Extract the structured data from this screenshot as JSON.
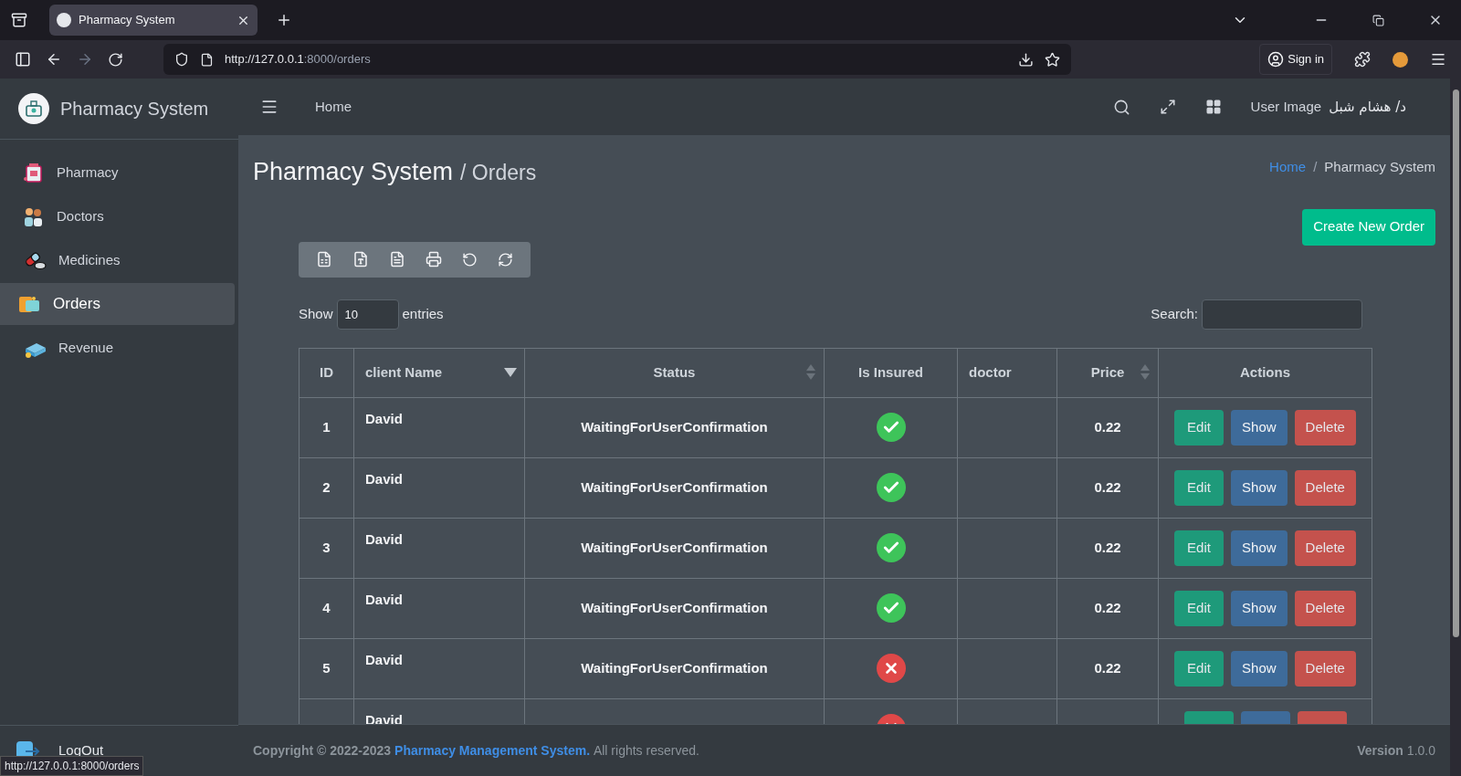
{
  "browser": {
    "tab_title": "Pharmacy System",
    "url_host": "http://127.0.0.1",
    "url_rest": ":8000/orders",
    "sign_in": "Sign in",
    "status_url": "http://127.0.0.1:8000/orders"
  },
  "sidebar": {
    "brand": "Pharmacy System",
    "items": [
      {
        "label": "Pharmacy",
        "kind": "pharmacy",
        "selected": false
      },
      {
        "label": "Doctors",
        "kind": "doctors",
        "selected": false
      },
      {
        "label": "Medicines",
        "kind": "medicines",
        "selected": false
      },
      {
        "label": "Orders",
        "kind": "orders",
        "selected": true
      },
      {
        "label": "Revenue",
        "kind": "revenue",
        "selected": false
      }
    ],
    "logout": "LogOut"
  },
  "header": {
    "home": "Home",
    "user_image": "User Image",
    "user_name": "د/ هشام شبل"
  },
  "page": {
    "title": "Pharmacy System",
    "subtitle": "/ Orders",
    "breadcrumb": [
      "Home",
      "Pharmacy System"
    ],
    "breadcrumb_separator": "/",
    "create_button": "Create New Order"
  },
  "length": {
    "show": "Show",
    "value": "10",
    "entries": "entries"
  },
  "search": {
    "label": "Search:"
  },
  "table": {
    "columns": [
      {
        "label": "ID",
        "sortable": false
      },
      {
        "label": "client Name",
        "sortable": true,
        "sorted_desc": true
      },
      {
        "label": "Status",
        "sortable": true,
        "sorted_desc": false
      },
      {
        "label": "Is Insured",
        "sortable": false
      },
      {
        "label": "doctor",
        "sortable": false
      },
      {
        "label": "Price",
        "sortable": true,
        "sorted_desc": false
      },
      {
        "label": "Actions",
        "sortable": false
      }
    ],
    "rows": [
      {
        "id": "1",
        "client_name": "David",
        "status": "WaitingForUserConfirmation",
        "insured": true,
        "price": "0.22",
        "buttons": [
          {
            "label": "Edit",
            "kind": "edit"
          },
          {
            "label": "Show",
            "kind": "show"
          },
          {
            "label": "Delete",
            "kind": "delete"
          }
        ]
      },
      {
        "id": "2",
        "client_name": "David",
        "status": "WaitingForUserConfirmation",
        "insured": true,
        "price": "0.22",
        "buttons": [
          {
            "label": "Edit",
            "kind": "edit"
          },
          {
            "label": "Show",
            "kind": "show"
          },
          {
            "label": "Delete",
            "kind": "delete"
          }
        ]
      },
      {
        "id": "3",
        "client_name": "David",
        "status": "WaitingForUserConfirmation",
        "insured": true,
        "price": "0.22",
        "buttons": [
          {
            "label": "Edit",
            "kind": "edit"
          },
          {
            "label": "Show",
            "kind": "show"
          },
          {
            "label": "Delete",
            "kind": "delete"
          }
        ]
      },
      {
        "id": "4",
        "client_name": "David",
        "status": "WaitingForUserConfirmation",
        "insured": true,
        "price": "0.22",
        "buttons": [
          {
            "label": "Edit",
            "kind": "edit"
          },
          {
            "label": "Show",
            "kind": "show"
          },
          {
            "label": "Delete",
            "kind": "delete"
          }
        ]
      },
      {
        "id": "5",
        "client_name": "David",
        "status": "WaitingForUserConfirmation",
        "insured": false,
        "price": "0.22",
        "buttons": [
          {
            "label": "Edit",
            "kind": "edit"
          },
          {
            "label": "Show",
            "kind": "show"
          },
          {
            "label": "Delete",
            "kind": "delete"
          }
        ]
      },
      {
        "client_name": "David",
        "insured": false,
        "buttons": [
          {
            "kind": "edit"
          },
          {
            "kind": "show"
          },
          {
            "kind": "delete"
          }
        ]
      }
    ]
  },
  "footer": {
    "copyright": "Copyright © 2022-2023",
    "link": "Pharmacy Management System.",
    "rights": "All rights reserved.",
    "version_label": "Version",
    "version": "1.0.0"
  }
}
